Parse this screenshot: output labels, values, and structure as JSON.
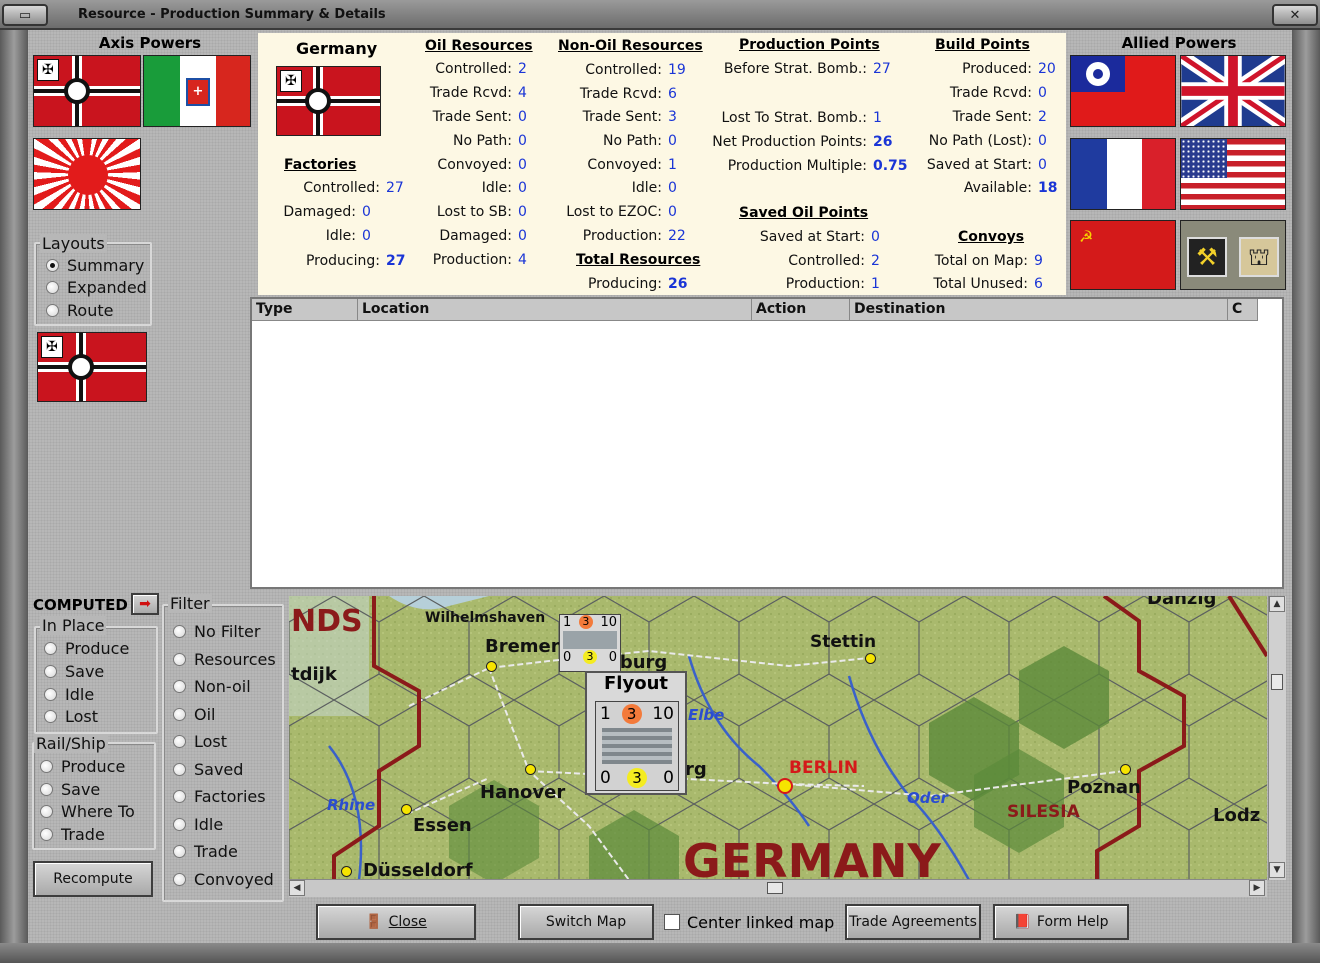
{
  "window": {
    "title": "Resource - Production Summary & Details",
    "axis_title": "Axis Powers",
    "allied_title": "Allied Powers"
  },
  "summary": {
    "country": "Germany",
    "factories": {
      "header": "Factories",
      "rows": [
        {
          "label": "Controlled:",
          "value": "27"
        },
        {
          "label": "Damaged:",
          "value": "0"
        },
        {
          "label": "Idle:",
          "value": "0"
        },
        {
          "label": "Producing:",
          "value": "27"
        }
      ]
    },
    "oil_resources": {
      "header": "Oil Resources",
      "rows": [
        {
          "label": "Controlled:",
          "value": "2"
        },
        {
          "label": "Trade Rcvd:",
          "value": "4"
        },
        {
          "label": "Trade Sent:",
          "value": "0"
        },
        {
          "label": "No Path:",
          "value": "0"
        },
        {
          "label": "Convoyed:",
          "value": "0"
        },
        {
          "label": "Idle:",
          "value": "0"
        },
        {
          "label": "Lost to SB:",
          "value": "0"
        },
        {
          "label": "Damaged:",
          "value": "0"
        },
        {
          "label": "Production:",
          "value": "4"
        }
      ]
    },
    "non_oil_resources": {
      "header": "Non-Oil Resources",
      "rows": [
        {
          "label": "Controlled:",
          "value": "19"
        },
        {
          "label": "Trade Rcvd:",
          "value": "6"
        },
        {
          "label": "Trade Sent:",
          "value": "3"
        },
        {
          "label": "No Path:",
          "value": "0"
        },
        {
          "label": "Convoyed:",
          "value": "1"
        },
        {
          "label": "Idle:",
          "value": "0"
        },
        {
          "label": "Lost to EZOC:",
          "value": "0"
        },
        {
          "label": "Production:",
          "value": "22"
        }
      ]
    },
    "total_resources": {
      "header": "Total Resources",
      "rows": [
        {
          "label": "Producing:",
          "value": "26"
        }
      ]
    },
    "production_points": {
      "header": "Production Points",
      "rows": [
        {
          "label": "Before Strat. Bomb.:",
          "value": "27"
        },
        {
          "label": "Lost To Strat. Bomb.:",
          "value": "1"
        },
        {
          "label": "Net Production Points:",
          "value": "26"
        },
        {
          "label": "Production Multiple:",
          "value": "0.75"
        }
      ]
    },
    "saved_oil_points": {
      "header": "Saved Oil Points",
      "rows": [
        {
          "label": "Saved at Start:",
          "value": "0"
        },
        {
          "label": "Controlled:",
          "value": "2"
        },
        {
          "label": "Production:",
          "value": "1"
        }
      ]
    },
    "build_points": {
      "header": "Build Points",
      "rows": [
        {
          "label": "Produced:",
          "value": "20"
        },
        {
          "label": "Trade Rcvd:",
          "value": "0"
        },
        {
          "label": "Trade Sent:",
          "value": "2"
        },
        {
          "label": "No Path (Lost):",
          "value": "0"
        },
        {
          "label": "Saved at Start:",
          "value": "0"
        },
        {
          "label": "Available:",
          "value": "18"
        }
      ]
    },
    "convoys": {
      "header": "Convoys",
      "rows": [
        {
          "label": "Total on Map:",
          "value": "9"
        },
        {
          "label": "Total Unused:",
          "value": "6"
        }
      ]
    }
  },
  "layouts": {
    "title": "Layouts",
    "options": [
      "Summary",
      "Expanded",
      "Route"
    ],
    "selected": "Summary"
  },
  "computed": {
    "label": "COMPUTED",
    "in_place": {
      "title": "In Place",
      "options": [
        "Produce",
        "Save",
        "Idle",
        "Lost"
      ]
    },
    "rail_ship": {
      "title": "Rail/Ship",
      "options": [
        "Produce",
        "Save",
        "Where To",
        "Trade"
      ]
    },
    "recompute": "Recompute"
  },
  "filter": {
    "title": "Filter",
    "options": [
      "No Filter",
      "Resources",
      "Non-oil",
      "Oil",
      "Lost",
      "Saved",
      "Factories",
      "Idle",
      "Trade",
      "Convoyed"
    ]
  },
  "table": {
    "columns": [
      "Type",
      "Location",
      "Action",
      "Destination",
      "C"
    ]
  },
  "map": {
    "labels": {
      "nds": "NDS",
      "tdijk": "tdijk",
      "wilhelmshaven": "Wilhelmshaven",
      "bremen": "Bremen",
      "hamburg": "nburg",
      "stettin": "Stettin",
      "danzig": "Danzig",
      "elbe": "Elbe",
      "hanover": "Hanover",
      "rhine": "Rhine",
      "essen": "Essen",
      "dusseldorf": "Düsseldorf",
      "berlin": "BERLIN",
      "oder": "Oder",
      "poznan": "Poznan",
      "silesia": "SILESIA",
      "lodz": "Lodz",
      "germany": "GERMANY",
      "rg": "rg"
    },
    "flyout": {
      "title": "Flyout",
      "top": [
        "1",
        "3",
        "10"
      ],
      "bottom": [
        "0",
        "3",
        "0"
      ]
    },
    "small_counter": {
      "top": [
        "1",
        "3",
        "10"
      ],
      "bottom": [
        "0",
        "3",
        "0"
      ]
    }
  },
  "buttons": {
    "close": "Close",
    "switch_map": "Switch Map",
    "center_linked_map": "Center linked map",
    "trade_agreements": "Trade Agreements",
    "form_help": "Form Help"
  },
  "colors": {
    "summary_bg": "#fdf8e4",
    "value_blue": "#1a35d6",
    "map_green": "#a4b56a",
    "border_red": "#8b1a1a"
  }
}
